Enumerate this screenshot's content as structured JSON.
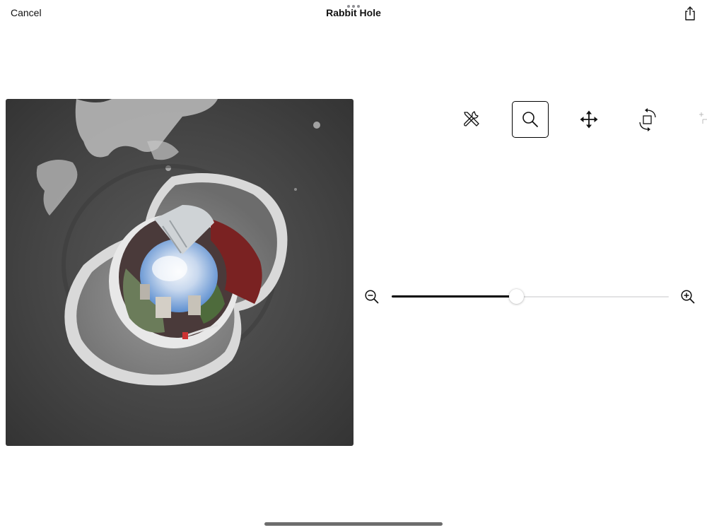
{
  "header": {
    "cancel_label": "Cancel",
    "title": "Rabbit Hole",
    "share_icon": "share-icon",
    "multitask_icon": "multitasking-dots-icon"
  },
  "photo": {
    "description_icon": "tiny-planet-photo"
  },
  "toolbar": {
    "tools": [
      {
        "icon": "tools-icon",
        "selected": false
      },
      {
        "icon": "magnifier-icon",
        "selected": true
      },
      {
        "icon": "move-arrows-icon",
        "selected": false
      },
      {
        "icon": "rotate-icon",
        "selected": false
      },
      {
        "icon": "additional-tool-icon",
        "selected": false
      }
    ]
  },
  "zoom": {
    "zoom_out_icon": "zoom-out-icon",
    "zoom_in_icon": "zoom-in-icon",
    "level": 0.45
  },
  "colors": {
    "accent": "#000000",
    "track": "#e2e2e4",
    "background": "#ffffff"
  }
}
